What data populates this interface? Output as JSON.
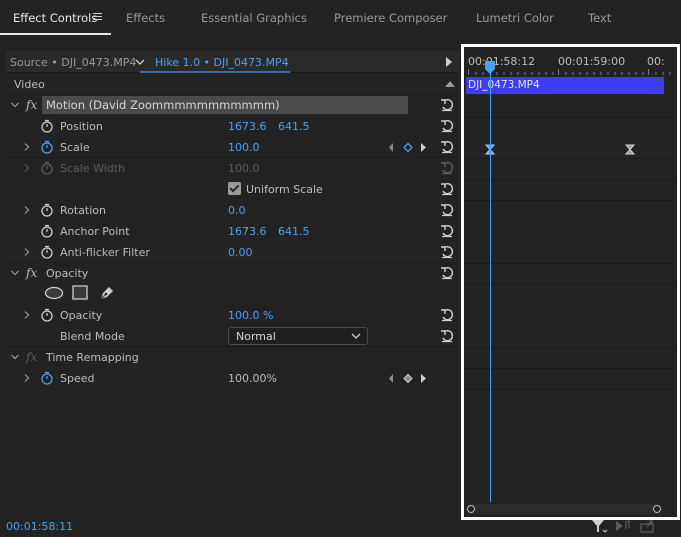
{
  "tabs": [
    {
      "label": "Effect Controls",
      "active": true
    },
    {
      "label": "Effects"
    },
    {
      "label": "Essential Graphics"
    },
    {
      "label": "Premiere Composer"
    },
    {
      "label": "Lumetri Color"
    },
    {
      "label": "Text"
    }
  ],
  "source": {
    "source_label": "Source • DJI_0473.MP4",
    "clip_label": "Hike 1.0 • DJI_0473.MP4"
  },
  "section": {
    "video": "Video"
  },
  "motion": {
    "title": "Motion (David Zoommmmmmmmmmm)",
    "position_label": "Position",
    "position_x": "1673.6",
    "position_y": "641.5",
    "scale_label": "Scale",
    "scale_value": "100.0",
    "scale_width_label": "Scale Width",
    "scale_width_value": "100.0",
    "uniform_scale_label": "Uniform Scale",
    "rotation_label": "Rotation",
    "rotation_value": "0.0",
    "anchor_label": "Anchor Point",
    "anchor_x": "1673.6",
    "anchor_y": "641.5",
    "antiflicker_label": "Anti-flicker Filter",
    "antiflicker_value": "0.00"
  },
  "opacity": {
    "title": "Opacity",
    "opacity_label": "Opacity",
    "opacity_value": "100.0 %",
    "blend_label": "Blend Mode",
    "blend_value": "Normal"
  },
  "time_remapping": {
    "title": "Time Remapping",
    "speed_label": "Speed",
    "speed_value": "100.00%"
  },
  "timeline": {
    "time_1": "00:01:58:12",
    "time_2": "00:01:59:00",
    "time_3": "00:",
    "clip_name": "DJI_0473.MP4"
  },
  "footer": {
    "timecode": "00:01:58:11"
  },
  "colors": {
    "accent_blue": "#4aa0f2",
    "clip_blue": "#3d3df2"
  }
}
